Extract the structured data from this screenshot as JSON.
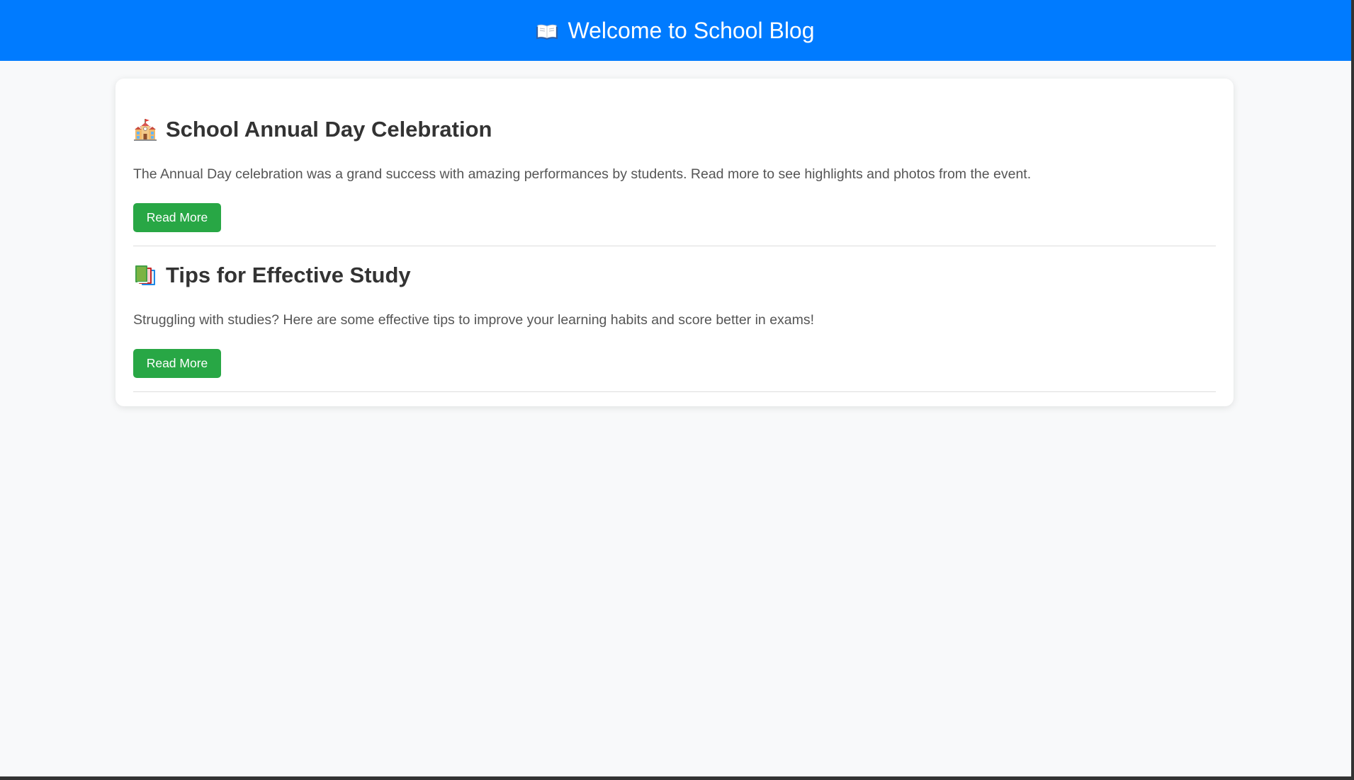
{
  "header": {
    "icon": "open-book-icon",
    "title": "Welcome to School Blog",
    "background": "#007bff"
  },
  "posts": [
    {
      "icon": "school-building-icon",
      "title": "School Annual Day Celebration",
      "excerpt": "The Annual Day celebration was a grand success with amazing performances by students. Read more to see highlights and photos from the event.",
      "button_label": "Read More"
    },
    {
      "icon": "books-icon",
      "title": "Tips for Effective Study",
      "excerpt": "Struggling with studies? Here are some effective tips to improve your learning habits and score better in exams!",
      "button_label": "Read More"
    }
  ],
  "colors": {
    "page_background": "#f8f9fa",
    "button": "#28a745",
    "title_text": "#333333",
    "body_text": "#555555"
  }
}
